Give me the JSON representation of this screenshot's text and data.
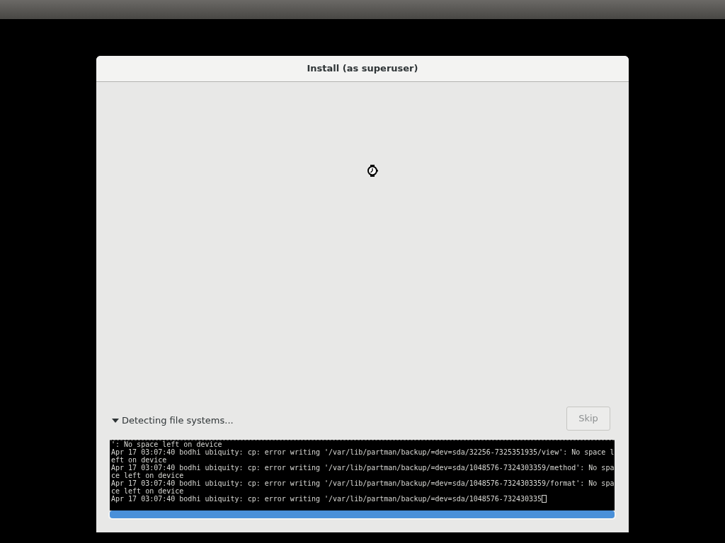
{
  "window": {
    "title": "Install (as superuser)"
  },
  "expander": {
    "label": "Detecting file systems...",
    "expanded": true
  },
  "skip_button": {
    "label": "Skip",
    "disabled": true
  },
  "terminal": {
    "lines": [
      "': No space left on device",
      "Apr 17 03:07:40 bodhi ubiquity: cp: error writing '/var/lib/partman/backup/=dev=sda/32256-7325351935/view': No space l",
      "eft on device",
      "Apr 17 03:07:40 bodhi ubiquity: cp: error writing '/var/lib/partman/backup/=dev=sda/1048576-7324303359/method': No spa",
      "ce left on device",
      "Apr 17 03:07:40 bodhi ubiquity: cp: error writing '/var/lib/partman/backup/=dev=sda/1048576-7324303359/format': No spa",
      "ce left on device",
      "Apr 17 03:07:40 bodhi ubiquity: cp: error writing '/var/lib/partman/backup/=dev=sda/1048576-732430335"
    ]
  },
  "progress": {
    "level": 1
  }
}
